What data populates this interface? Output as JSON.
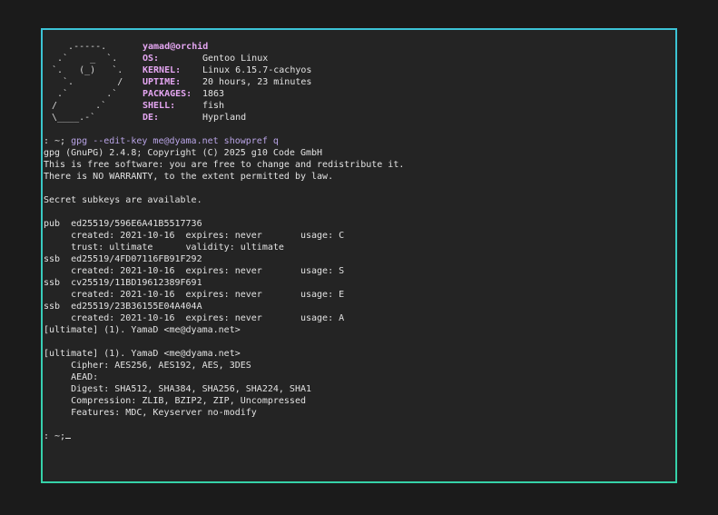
{
  "accent_colors": {
    "border_top": "#3cc3d6",
    "border_bottom": "#36d2a8",
    "fetch_key": "#e5a6f2",
    "command": "#b9a4e6"
  },
  "fetch": {
    "logo": "   .-----.      \n .`    _  `.    \n`.   (_)   `.  \n  `.        /  \n .`       .`   \n/       .`     \n\\____.-`       ",
    "user": "yamad",
    "at": "@",
    "host": "orchid",
    "rows": [
      {
        "key": "OS:",
        "value": "Gentoo Linux"
      },
      {
        "key": "KERNEL:",
        "value": "Linux 6.15.7-cachyos"
      },
      {
        "key": "UPTIME:",
        "value": "20 hours, 23 minutes"
      },
      {
        "key": "PACKAGES:",
        "value": "1863"
      },
      {
        "key": "SHELL:",
        "value": "fish"
      },
      {
        "key": "DE:",
        "value": "Hyprland"
      }
    ]
  },
  "prompt": {
    "symbol": ": ~; ",
    "command": "gpg --edit-key me@dyama.net showpref q",
    "final_symbol": ": ~;"
  },
  "output_lines": [
    "gpg (GnuPG) 2.4.8; Copyright (C) 2025 g10 Code GmbH",
    "This is free software: you are free to change and redistribute it.",
    "There is NO WARRANTY, to the extent permitted by law.",
    "",
    "Secret subkeys are available.",
    "",
    "pub  ed25519/596E6A41B5517736",
    "     created: 2021-10-16  expires: never       usage: C",
    "     trust: ultimate      validity: ultimate",
    "ssb  ed25519/4FD07116FB91F292",
    "     created: 2021-10-16  expires: never       usage: S",
    "ssb  cv25519/11BD19612389F691",
    "     created: 2021-10-16  expires: never       usage: E",
    "ssb  ed25519/23B36155E04A404A",
    "     created: 2021-10-16  expires: never       usage: A",
    "[ultimate] (1). YamaD <me@dyama.net>",
    "",
    "[ultimate] (1). YamaD <me@dyama.net>",
    "     Cipher: AES256, AES192, AES, 3DES",
    "     AEAD:",
    "     Digest: SHA512, SHA384, SHA256, SHA224, SHA1",
    "     Compression: ZLIB, BZIP2, ZIP, Uncompressed",
    "     Features: MDC, Keyserver no-modify",
    ""
  ]
}
